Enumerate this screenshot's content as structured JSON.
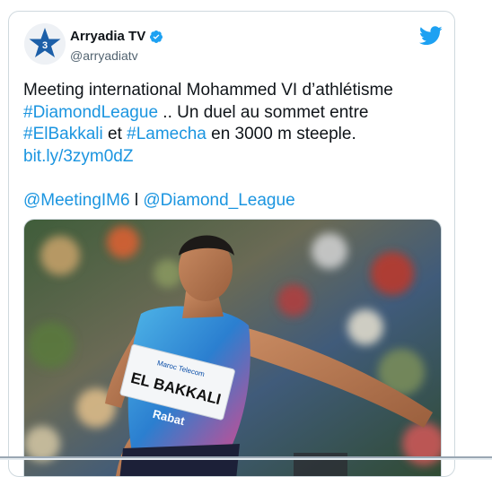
{
  "tweet": {
    "display_name": "Arryadia TV",
    "handle": "@arryadiatv",
    "verified_icon": "verified-badge-icon",
    "logo_icon": "twitter-bird-icon",
    "text_line1": "Meeting international Mohammed VI d’athlétisme",
    "hashtag_diamond": "#DiamondLeague",
    "text_line2_rest": " .. Un duel au sommet entre",
    "hashtag_elbakkali": "#ElBakkali",
    "text_et": " et ",
    "hashtag_lamecha": "#Lamecha",
    "text_line3_rest": " en 3000 m steeple.",
    "short_link": "bit.ly/3zym0dZ",
    "mention_meeting": "@MeetingIM6",
    "separator": " l ",
    "mention_diamond": "@Diamond_League"
  },
  "media": {
    "bib_name": "EL BAKKALI",
    "bib_sponsor": "Maroc Telecom",
    "bib_city": "Rabat"
  },
  "colors": {
    "link": "#1b95e0",
    "text": "#0f1419",
    "muted": "#536471",
    "twitter_blue": "#1da1f2"
  }
}
